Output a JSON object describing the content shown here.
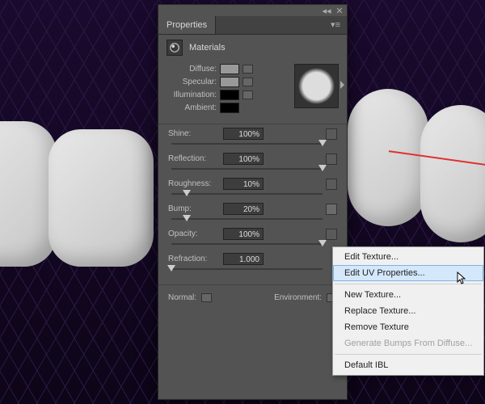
{
  "panel": {
    "title": "Properties",
    "section_title": "Materials",
    "swatches": {
      "diffuse": "Diffuse:",
      "specular": "Specular:",
      "illumination": "Illumination:",
      "ambient": "Ambient:"
    }
  },
  "sliders": {
    "shine": {
      "label": "Shine:",
      "value": "100%",
      "pos": 100
    },
    "reflection": {
      "label": "Reflection:",
      "value": "100%",
      "pos": 100
    },
    "roughness": {
      "label": "Roughness:",
      "value": "10%",
      "pos": 10
    },
    "bump": {
      "label": "Bump:",
      "value": "20%",
      "pos": 10
    },
    "opacity": {
      "label": "Opacity:",
      "value": "100%",
      "pos": 100
    },
    "refraction": {
      "label": "Refraction:",
      "value": "1.000",
      "pos": 0
    }
  },
  "bottom": {
    "normal": "Normal:",
    "environment": "Environment:"
  },
  "menu": {
    "edit_texture": "Edit Texture...",
    "edit_uv": "Edit UV Properties...",
    "new_texture": "New Texture...",
    "replace_texture": "Replace Texture...",
    "remove_texture": "Remove Texture",
    "gen_bumps": "Generate Bumps From Diffuse...",
    "default_ibl": "Default IBL"
  }
}
